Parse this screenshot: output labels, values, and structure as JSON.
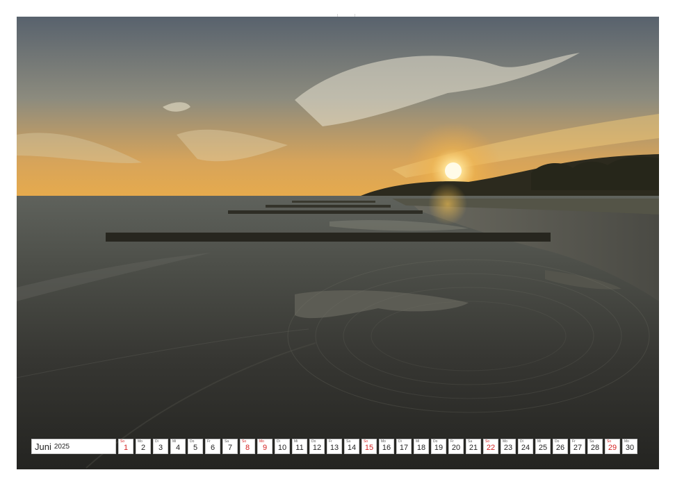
{
  "calendar": {
    "month": "Juni",
    "year": "2025",
    "days": [
      {
        "wd": "So",
        "n": "1",
        "sun": true
      },
      {
        "wd": "Mo",
        "n": "2"
      },
      {
        "wd": "Di",
        "n": "3"
      },
      {
        "wd": "Mi",
        "n": "4"
      },
      {
        "wd": "Do",
        "n": "5"
      },
      {
        "wd": "Fr",
        "n": "6"
      },
      {
        "wd": "Sa",
        "n": "7"
      },
      {
        "wd": "So",
        "n": "8",
        "sun": true
      },
      {
        "wd": "Mo",
        "n": "9",
        "sun": true
      },
      {
        "wd": "Di",
        "n": "10"
      },
      {
        "wd": "Mi",
        "n": "11"
      },
      {
        "wd": "Do",
        "n": "12"
      },
      {
        "wd": "Fr",
        "n": "13"
      },
      {
        "wd": "Sa",
        "n": "14"
      },
      {
        "wd": "So",
        "n": "15",
        "sun": true
      },
      {
        "wd": "Mo",
        "n": "16"
      },
      {
        "wd": "Di",
        "n": "17"
      },
      {
        "wd": "Mi",
        "n": "18"
      },
      {
        "wd": "Do",
        "n": "19"
      },
      {
        "wd": "Fr",
        "n": "20"
      },
      {
        "wd": "Sa",
        "n": "21"
      },
      {
        "wd": "So",
        "n": "22",
        "sun": true
      },
      {
        "wd": "Mo",
        "n": "23"
      },
      {
        "wd": "Di",
        "n": "24"
      },
      {
        "wd": "Mi",
        "n": "25"
      },
      {
        "wd": "Do",
        "n": "26"
      },
      {
        "wd": "Fr",
        "n": "27"
      },
      {
        "wd": "Sa",
        "n": "28"
      },
      {
        "wd": "So",
        "n": "29",
        "sun": true
      },
      {
        "wd": "Mo",
        "n": "30"
      }
    ]
  },
  "colors": {
    "sunday": "#d32020",
    "sky_top": "#55606b",
    "sky_glow": "#e6a84e",
    "sea_dark": "#2c2c28",
    "sun": "#fff3c4"
  }
}
